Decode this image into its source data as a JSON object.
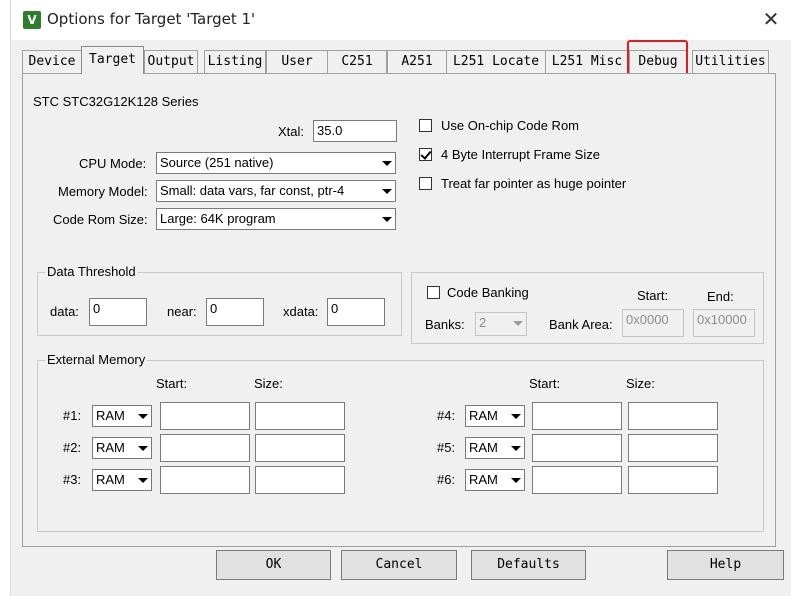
{
  "window": {
    "title": "Options for Target 'Target 1'",
    "app_icon_letter": "V",
    "close_symbol": "✕"
  },
  "tabs": [
    "Device",
    "Target",
    "Output",
    "Listing",
    "User",
    "C251",
    "A251",
    "L251 Locate",
    "L251 Misc",
    "Debug",
    "Utilities"
  ],
  "active_tab": "Target",
  "highlighted_tab": "Debug",
  "highlight_color": "#e8191c",
  "target": {
    "device_name": "STC STC32G12K128 Series",
    "xtal_label": "Xtal:",
    "xtal_value": "35.0",
    "cpu_mode_label": "CPU Mode:",
    "cpu_mode_value": "Source (251 native)",
    "memory_model_label": "Memory Model:",
    "memory_model_value": "Small: data vars, far const, ptr-4",
    "code_rom_size_label": "Code Rom Size:",
    "code_rom_size_value": "Large: 64K program",
    "use_onchip_code_rom": {
      "label": "Use On-chip Code Rom",
      "checked": false
    },
    "four_byte_interrupt": {
      "label": "4 Byte Interrupt Frame Size",
      "checked": true
    },
    "treat_far_pointer": {
      "label": "Treat far pointer as huge pointer",
      "checked": false
    }
  },
  "data_threshold": {
    "title": "Data Threshold",
    "data_label": "data:",
    "data_value": "0",
    "near_label": "near:",
    "near_value": "0",
    "xdata_label": "xdata:",
    "xdata_value": "0"
  },
  "code_banking": {
    "label": "Code Banking",
    "checked": false,
    "banks_label": "Banks:",
    "banks_value": "2",
    "bank_area_label": "Bank Area:",
    "start_label": "Start:",
    "end_label": "End:",
    "start_value": "0x0000",
    "end_value": "0x10000"
  },
  "external_memory": {
    "title": "External Memory",
    "start_header": "Start:",
    "size_header": "Size:",
    "rows": [
      {
        "label": "#1:",
        "type": "RAM",
        "start": "",
        "size": ""
      },
      {
        "label": "#2:",
        "type": "RAM",
        "start": "",
        "size": ""
      },
      {
        "label": "#3:",
        "type": "RAM",
        "start": "",
        "size": ""
      },
      {
        "label": "#4:",
        "type": "RAM",
        "start": "",
        "size": ""
      },
      {
        "label": "#5:",
        "type": "RAM",
        "start": "",
        "size": ""
      },
      {
        "label": "#6:",
        "type": "RAM",
        "start": "",
        "size": ""
      }
    ]
  },
  "buttons": {
    "ok": "OK",
    "cancel": "Cancel",
    "defaults": "Defaults",
    "help": "Help"
  }
}
